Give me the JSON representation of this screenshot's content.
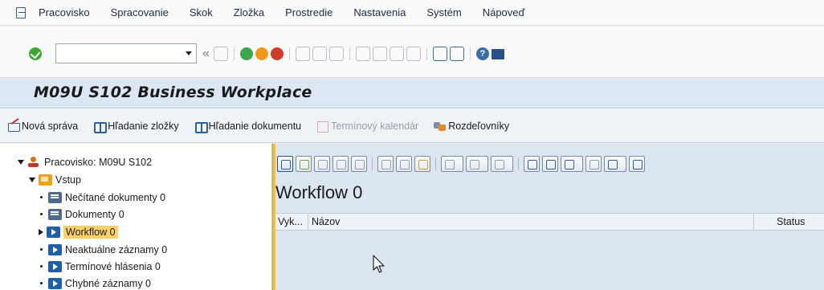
{
  "menubar": {
    "items": [
      "Pracovisko",
      "Spracovanie",
      "Skok",
      "Zložka",
      "Prostredie",
      "Nastavenia",
      "Systém",
      "Nápoveď"
    ]
  },
  "toolbar": {
    "command_field_value": "",
    "icons": [
      "back-chevron-icon",
      "save-icon",
      "back-icon",
      "exit-icon",
      "cancel-icon",
      "print-icon",
      "find-icon",
      "find-next-icon",
      "first-page-icon",
      "previous-page-icon",
      "next-page-icon",
      "last-page-icon",
      "create-session-icon",
      "shortcut-icon",
      "help-icon",
      "customize-layout-icon"
    ]
  },
  "title": {
    "text": "M09U S102 Business Workplace"
  },
  "apptoolbar": {
    "new_message": "Nová správa",
    "find_folder": "Hľadanie zložky",
    "find_document": "Hľadanie dokumentu",
    "appointment_calendar": "Termínový kalendár",
    "distribution_lists": "Rozdeľovníky"
  },
  "tree": {
    "root": "Pracovisko: M09U S102",
    "inbox": "Vstup",
    "items": [
      {
        "label": "Nečítané dokumenty 0"
      },
      {
        "label": "Dokumenty 0"
      },
      {
        "label": "Workflow 0"
      },
      {
        "label": "Neaktuálne záznamy 0"
      },
      {
        "label": "Termínové hlásenia 0"
      },
      {
        "label": "Chybné záznamy 0"
      }
    ]
  },
  "content": {
    "title": "Workflow 0",
    "columns": {
      "col1": "Vyk...",
      "col2": "Názov",
      "col3": "Status"
    }
  },
  "colors": {
    "title_bg": "#dbe8f4",
    "content_bg": "#dbe6f1",
    "selected_bg": "#fdd068",
    "splitter": "#f1c232"
  }
}
